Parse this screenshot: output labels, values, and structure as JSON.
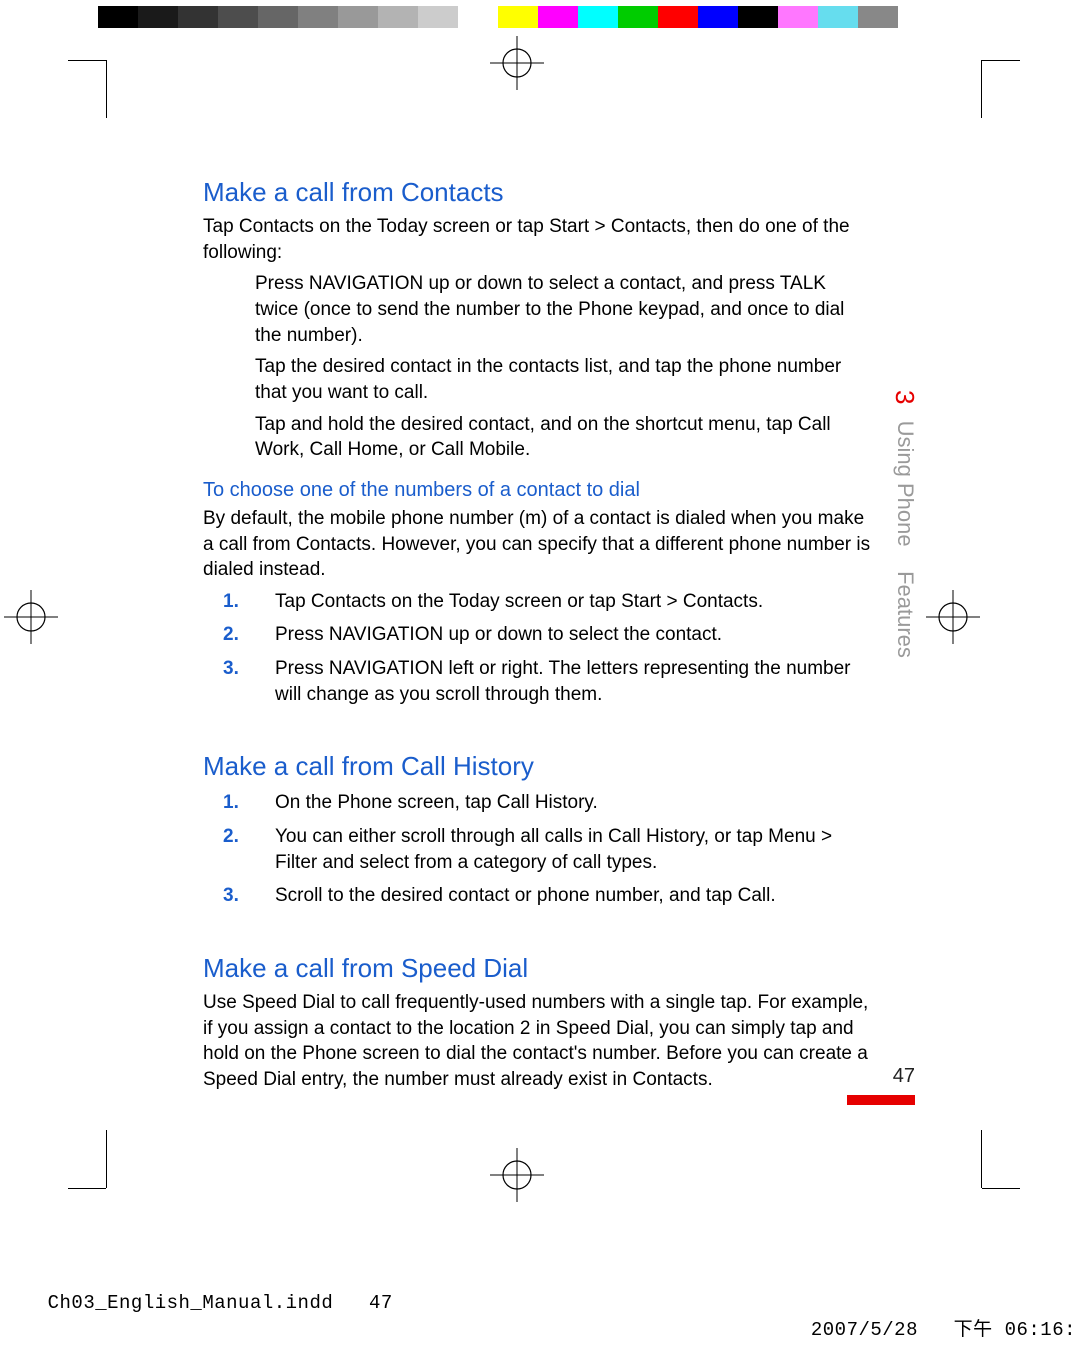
{
  "sections": {
    "s1": {
      "heading": "Make a call from Contacts",
      "intro": "Tap Contacts on the Today screen or tap Start > Contacts, then do one of the following:",
      "bullets": [
        "Press NAVIGATION up or down to select a contact, and press TALK twice (once to send the number to the Phone keypad, and once to dial the number).",
        "Tap the desired contact in the contacts list, and tap the phone number that you want to call.",
        "Tap and hold the desired contact, and on the shortcut menu, tap Call Work, Call Home, or Call Mobile."
      ],
      "sub_heading": "To choose one of the numbers of a contact to dial",
      "sub_intro": "By default, the mobile phone number (m) of a contact is dialed when you make a call from Contacts. However, you can specify that a different phone number is dialed instead.",
      "steps": [
        "Tap Contacts on the Today screen or tap Start > Contacts.",
        "Press NAVIGATION up or down to select the contact.",
        "Press NAVIGATION left or right. The letters representing the number will change as you scroll through them."
      ]
    },
    "s2": {
      "heading": "Make a call from Call History",
      "steps": [
        "On the Phone screen, tap Call History.",
        "You can either scroll through all calls in Call History, or tap Menu > Filter and select from a category of call types.",
        "Scroll to the desired contact or phone number, and tap Call."
      ]
    },
    "s3": {
      "heading": "Make a call from Speed Dial",
      "body": "Use Speed Dial to call frequently-used numbers with a single tap. For example, if you assign a contact to the location 2 in Speed Dial, you can simply tap and hold        on the Phone screen to dial the contact's number. Before you can create a Speed Dial entry, the number must already exist in Contacts."
    }
  },
  "side": {
    "chapter": "3",
    "title_a": "Using Phone",
    "title_b": "Features"
  },
  "page_number": "47",
  "slug": {
    "left": "Ch03_English_Manual.indd   47",
    "right": "2007/5/28   下午 06:16:"
  },
  "list_numbers": {
    "n1": "1.",
    "n2": "2.",
    "n3": "3."
  }
}
